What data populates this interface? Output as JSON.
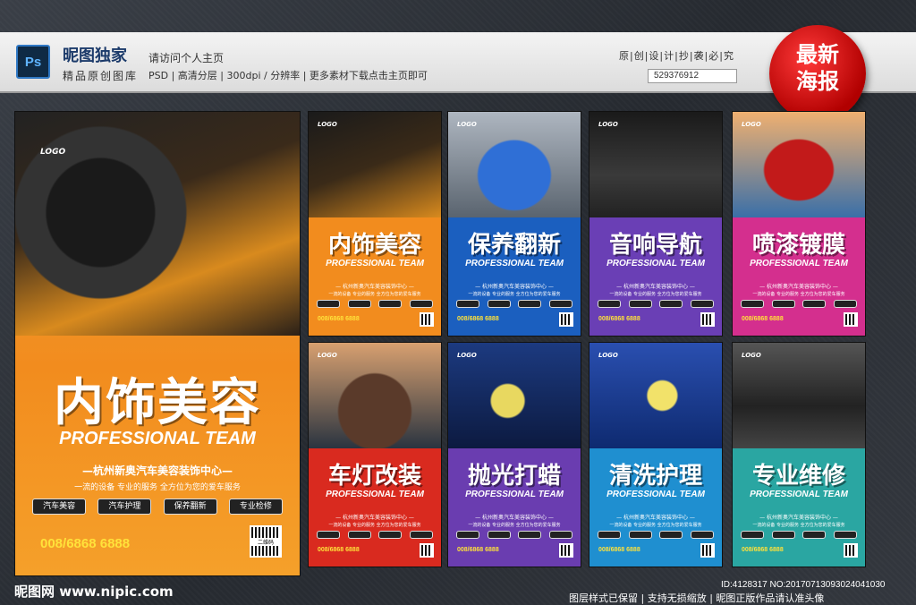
{
  "header": {
    "app_icon": "Ps",
    "brand": "昵图独家",
    "brand_sub": "精品原创图库",
    "visit": "请访问个人主页",
    "specs": "PSD | 高清分层 | 300dpi / 分辨率 | 更多素材下载点击主页即可",
    "original": "原|创|设|计|抄|袭|必|究",
    "id_box": "529376912",
    "badge_line1": "最新",
    "badge_line2": "海报"
  },
  "big_poster": {
    "logo": "LOGO",
    "title": "内饰美容",
    "en": "PROFESSIONAL TEAM",
    "shop": "—杭州新奥汽车美容装饰中心—",
    "services": "一流的设备  专业的服务  全方位为您的爱车服务",
    "buttons": [
      "汽车美容",
      "汽车护理",
      "保养翻新",
      "专业检修"
    ],
    "phone": "008/6868 6888",
    "qr": "二维码"
  },
  "posters": [
    {
      "title": "内饰美容",
      "en": "PROFESSIONAL TEAM",
      "theme": "#f28c1e"
    },
    {
      "title": "保养翻新",
      "en": "PROFESSIONAL TEAM",
      "theme": "#1b5fbf"
    },
    {
      "title": "音响导航",
      "en": "PROFESSIONAL TEAM",
      "theme": "#6a3fb5"
    },
    {
      "title": "喷漆镀膜",
      "en": "PROFESSIONAL TEAM",
      "theme": "#d42f8e"
    },
    {
      "title": "车灯改装",
      "en": "PROFESSIONAL TEAM",
      "theme": "#d92a1f"
    },
    {
      "title": "抛光打蜡",
      "en": "PROFESSIONAL TEAM",
      "theme": "#6a3db0"
    },
    {
      "title": "清洗护理",
      "en": "PROFESSIONAL TEAM",
      "theme": "#1f8fd0"
    },
    {
      "title": "专业维修",
      "en": "PROFESSIONAL TEAM",
      "theme": "#2aa6a2"
    }
  ],
  "poster_common": {
    "logo": "LOGO",
    "shop": "— 杭州新奥汽车美容装饰中心 —",
    "services": "一流的设备  专业的服务  全方位为您的爱车服务",
    "phone": "008/6868 6888"
  },
  "footer": {
    "site": "昵图网 www.nipic.com",
    "id": "ID:4128317 NO:20170713093024041030",
    "notice": "图层样式已保留 | 支持无损缩放 | 昵图正版作品请认准头像"
  }
}
